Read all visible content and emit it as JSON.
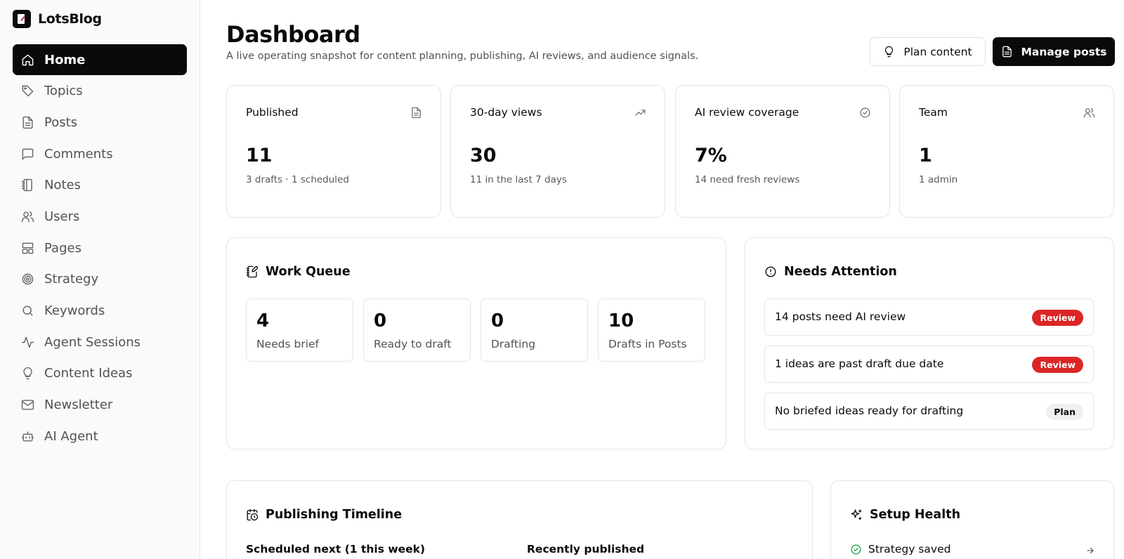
{
  "app": {
    "name": "LotsBlog"
  },
  "sidebar": {
    "items": [
      {
        "label": "Home",
        "icon": "home-icon"
      },
      {
        "label": "Topics",
        "icon": "tag-icon"
      },
      {
        "label": "Posts",
        "icon": "file-text-icon"
      },
      {
        "label": "Comments",
        "icon": "message-square-icon"
      },
      {
        "label": "Notes",
        "icon": "notebook-icon"
      },
      {
        "label": "Users",
        "icon": "users-icon"
      },
      {
        "label": "Pages",
        "icon": "layout-icon"
      },
      {
        "label": "Strategy",
        "icon": "target-icon"
      },
      {
        "label": "Keywords",
        "icon": "search-icon"
      },
      {
        "label": "Agent Sessions",
        "icon": "activity-icon"
      },
      {
        "label": "Content Ideas",
        "icon": "lightbulb-icon"
      },
      {
        "label": "Newsletter",
        "icon": "mail-icon"
      },
      {
        "label": "AI Agent",
        "icon": "bot-icon"
      }
    ],
    "active": "Home"
  },
  "header": {
    "title": "Dashboard",
    "subtitle": "A live operating snapshot for content planning, publishing, AI reviews, and audience signals.",
    "plan_button": "Plan content",
    "manage_button": "Manage posts"
  },
  "stats": [
    {
      "label": "Published",
      "value": "11",
      "sub": "3 drafts · 1 scheduled",
      "icon": "file-text-icon"
    },
    {
      "label": "30-day views",
      "value": "30",
      "sub": "11 in the last 7 days",
      "icon": "trending-up-icon"
    },
    {
      "label": "AI review coverage",
      "value": "7%",
      "sub": "14 need fresh reviews",
      "icon": "check-circle-icon"
    },
    {
      "label": "Team",
      "value": "1",
      "sub": "1 admin",
      "icon": "users-icon"
    }
  ],
  "work_queue": {
    "title": "Work Queue",
    "items": [
      {
        "value": "4",
        "label": "Needs brief"
      },
      {
        "value": "0",
        "label": "Ready to draft"
      },
      {
        "value": "0",
        "label": "Drafting"
      },
      {
        "value": "10",
        "label": "Drafts in Posts"
      }
    ]
  },
  "attention": {
    "title": "Needs Attention",
    "items": [
      {
        "text": "14 posts need AI review",
        "badge": "Review",
        "badge_color": "#dc2626"
      },
      {
        "text": "1 ideas are past draft due date",
        "badge": "Review",
        "badge_color": "#dc2626"
      },
      {
        "text": "No briefed ideas ready for drafting",
        "badge": "Plan",
        "badge_color": "#f0f0f0"
      }
    ]
  },
  "timeline": {
    "title": "Publishing Timeline",
    "scheduled_heading": "Scheduled next (1 this week)",
    "recent_heading": "Recently published"
  },
  "setup_health": {
    "title": "Setup Health",
    "items": [
      {
        "label": "Strategy saved",
        "status": "ok"
      }
    ]
  }
}
